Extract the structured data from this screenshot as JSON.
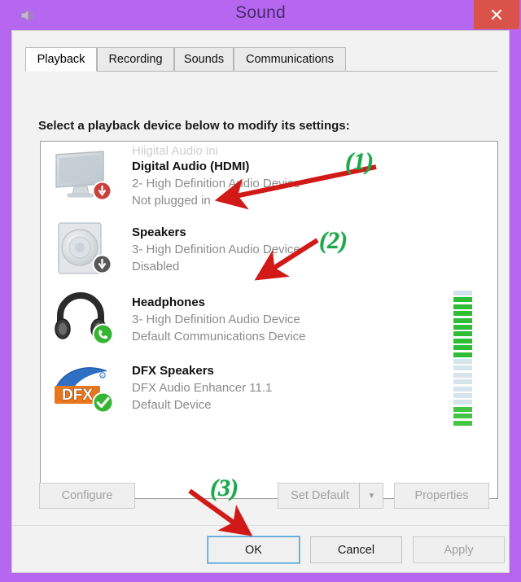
{
  "window": {
    "title": "Sound",
    "icon": "speaker-icon",
    "close_label": "×",
    "accent_titlebar": "#b567f0",
    "close_color": "#d9534a"
  },
  "tabs": [
    {
      "label": "Playback",
      "active": true
    },
    {
      "label": "Recording",
      "active": false
    },
    {
      "label": "Sounds",
      "active": false
    },
    {
      "label": "Communications",
      "active": false
    }
  ],
  "instruction": "Select a playback device below to modify its settings:",
  "devices": [
    {
      "ghost_text": "Hiigital Audio ini",
      "name": "Digital Audio (HDMI)",
      "driver": "2- High Definition Audio Device",
      "status": "Not plugged in",
      "icon": "monitor-icon",
      "badge": "red-down-arrow-badge",
      "meter": {
        "total": 10,
        "active": 0
      }
    },
    {
      "ghost_text": "",
      "name": "Speakers",
      "driver": "3- High Definition Audio Device",
      "status": "Disabled",
      "icon": "desktop-speaker-icon",
      "badge": "gray-down-arrow-badge",
      "meter": {
        "total": 10,
        "active": 0
      }
    },
    {
      "ghost_text": "",
      "name": "Headphones",
      "driver": "3- High Definition Audio Device",
      "status": "Default Communications Device",
      "icon": "headphones-icon",
      "badge": "green-phone-badge",
      "meter": {
        "total": 10,
        "active": 9
      }
    },
    {
      "ghost_text": "",
      "name": "DFX Speakers",
      "driver": "DFX Audio Enhancer 11.1",
      "status": "Default Device",
      "icon": "dfx-logo-icon",
      "badge": "green-check-badge",
      "meter": {
        "total": 10,
        "active": 3
      }
    }
  ],
  "buttons": {
    "configure": "Configure",
    "set_default": "Set Default",
    "set_default_arrow": "▼",
    "properties": "Properties",
    "ok": "OK",
    "cancel": "Cancel",
    "apply": "Apply"
  },
  "annotations": {
    "color": "#1ba84a",
    "arrow_color": "#d11a17",
    "items": [
      {
        "label": "(1)",
        "target": "speakers-device-row"
      },
      {
        "label": "(2)",
        "target": "headphones-device-row"
      },
      {
        "label": "(3)",
        "target": "ok-button"
      }
    ]
  }
}
